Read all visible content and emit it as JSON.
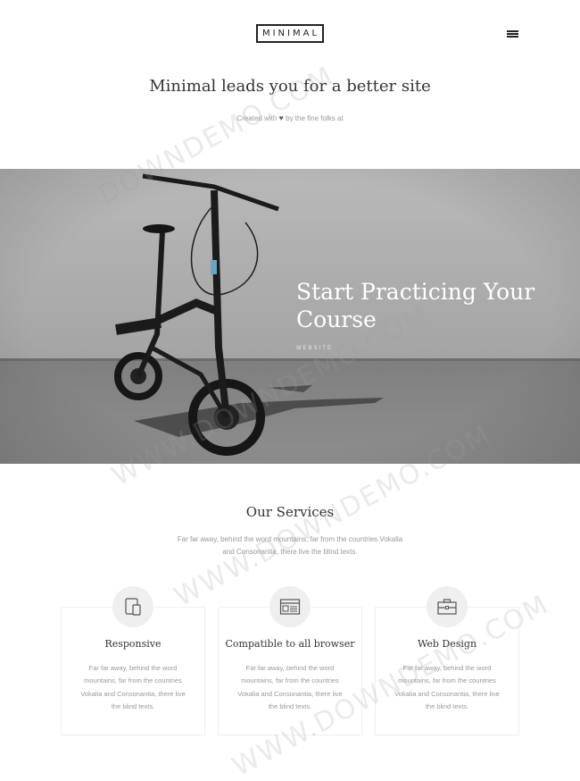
{
  "header": {
    "logo": "MINIMAL",
    "menu_icon": "hamburger-menu-icon"
  },
  "intro": {
    "title": "Minimal leads you for a better site",
    "subtitle_before": "Created with",
    "subtitle_heart": "♥",
    "subtitle_after": "by the fine folks at"
  },
  "hero": {
    "title": "Start Practicing Your Course",
    "tag": "WEBSITE"
  },
  "services": {
    "title": "Our Services",
    "description": "Far far away, behind the word mountains, far from the countries Vokalia and Consonantia, there live the blind texts.",
    "items": [
      {
        "icon": "devices-icon",
        "title": "Responsive",
        "text": "Far far away, behind the word mountains, far from the countries Vokalia and Consonantia, there live the blind texts."
      },
      {
        "icon": "browser-window-icon",
        "title": "Compatible to all browser",
        "text": "Far far away, behind the word mountains, far from the countries Vokalia and Consonantia, there live the blind texts."
      },
      {
        "icon": "briefcase-icon",
        "title": "Web Design",
        "text": "Far far away, behind the word mountains, far from the countries Vokalia and Consonantia, there live the blind texts."
      }
    ]
  },
  "watermark": {
    "text_1": "DOWNDEMO.COM",
    "text_2": "WWW.DOWNDEMO.COM",
    "text_3": "WWW.DOWNDEMO.COM",
    "text_4": "WWW.DOWNDEMO.COM"
  }
}
